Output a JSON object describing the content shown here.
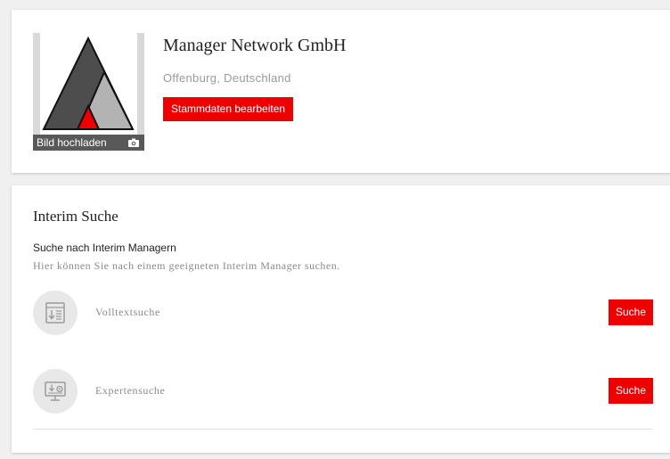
{
  "profile": {
    "company_name": "Manager Network GmbH",
    "location": "Offenburg, Deutschland",
    "edit_label": "Stammdaten bearbeiten",
    "upload_label": "Bild hochladen",
    "upload_icon": "camera-icon",
    "logo_icon": "triangle-logo"
  },
  "interim_search": {
    "title": "Interim Suche",
    "subtitle": "Suche nach Interim Managern",
    "description": "Hier können Sie nach einem geeigneten Interim Manager suchen.",
    "options": [
      {
        "label": "Volltextsuche",
        "icon": "document-search-icon",
        "button_label": "Suche"
      },
      {
        "label": "Expertensuche",
        "icon": "monitor-expert-icon",
        "button_label": "Suche"
      }
    ]
  },
  "colors": {
    "accent": "#ee0000",
    "upload_bar": "#595959",
    "icon_circle": "#e8e8e8",
    "muted_text": "#8a8a8a"
  }
}
